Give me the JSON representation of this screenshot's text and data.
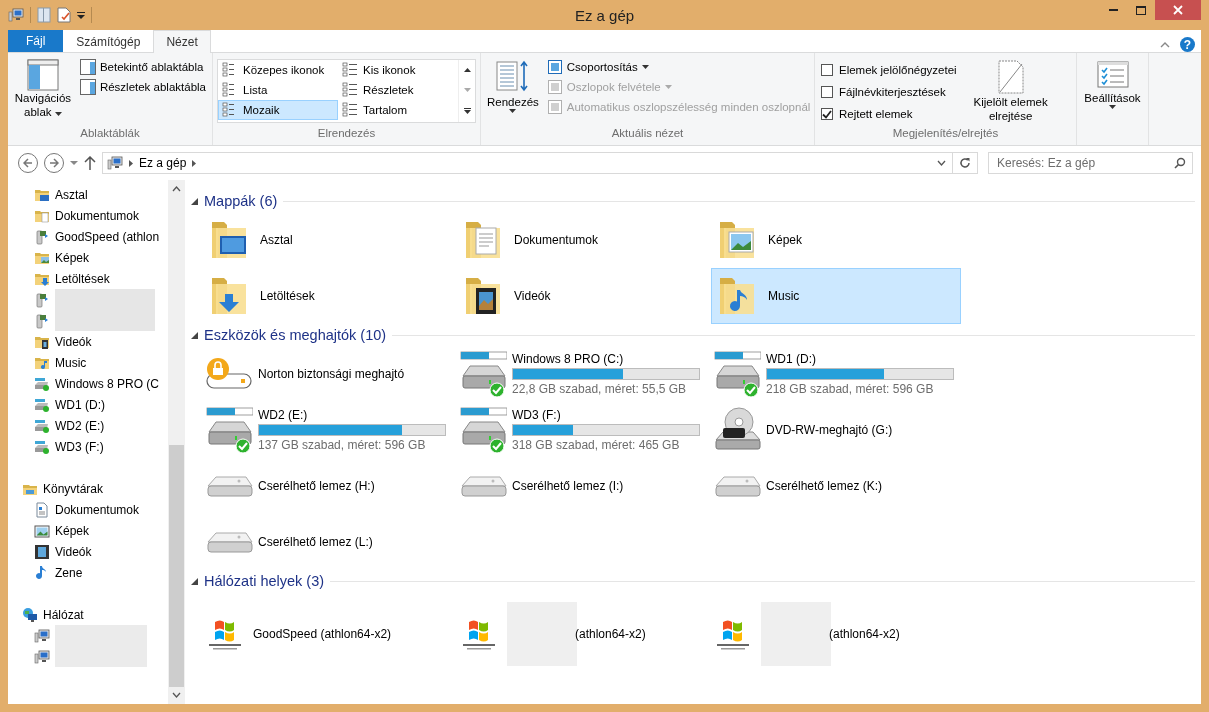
{
  "window": {
    "title": "Ez a gép"
  },
  "tabs": [
    {
      "label": "Fájl",
      "kind": "file",
      "selected": false
    },
    {
      "label": "Számítógép",
      "kind": "tab",
      "selected": false
    },
    {
      "label": "Nézet",
      "kind": "tab",
      "selected": true
    }
  ],
  "ribbon": {
    "panes": {
      "nav_pane": "Navigációs ablak",
      "items": [
        "Betekintő ablaktábla",
        "Részletek ablaktábla"
      ],
      "group": "Ablaktáblák"
    },
    "layout": {
      "options": [
        {
          "label": "Közepes ikonok",
          "selected": false
        },
        {
          "label": "Kis ikonok",
          "selected": false
        },
        {
          "label": "Lista",
          "selected": false
        },
        {
          "label": "Részletek",
          "selected": false
        },
        {
          "label": "Mozaik",
          "selected": true
        },
        {
          "label": "Tartalom",
          "selected": false
        }
      ],
      "group": "Elrendezés"
    },
    "current_view": {
      "sort": "Rendezés",
      "items": [
        {
          "label": "Csoportosítás",
          "disabled": false,
          "dropdown": true
        },
        {
          "label": "Oszlopok felvétele",
          "disabled": true,
          "dropdown": true
        },
        {
          "label": "Automatikus oszlopszélesség minden oszlopnál",
          "disabled": true,
          "dropdown": false
        }
      ],
      "group": "Aktuális nézet"
    },
    "show_hide": {
      "checkboxes": [
        {
          "label": "Elemek jelölőnégyzetei",
          "checked": false
        },
        {
          "label": "Fájlnévkiterjesztések",
          "checked": false
        },
        {
          "label": "Rejtett elemek",
          "checked": true
        }
      ],
      "hide_selected": "Kijelölt elemek elrejtése",
      "group": "Megjelenítés/elrejtés"
    },
    "options": "Beállítások",
    "help": "?"
  },
  "address": {
    "path": [
      "Ez a gép"
    ],
    "search_placeholder": "Keresés: Ez a gép"
  },
  "sidebar": {
    "sections": [
      {
        "items": [
          {
            "label": "Asztal",
            "kind": "desktop",
            "redacted": false
          },
          {
            "label": "Dokumentumok",
            "kind": "documents",
            "redacted": false
          },
          {
            "label": "GoodSpeed (athlon",
            "kind": "media",
            "redacted": false
          },
          {
            "label": "Képek",
            "kind": "pictures",
            "redacted": false
          },
          {
            "label": "Letöltések",
            "kind": "downloads",
            "redacted": false
          },
          {
            "kind": "media",
            "redacted": true
          },
          {
            "kind": "media",
            "redacted": true
          },
          {
            "label": "Videók",
            "kind": "videos",
            "redacted": false
          },
          {
            "label": "Music",
            "kind": "music",
            "redacted": false
          },
          {
            "label": "Windows 8 PRO (C",
            "kind": "drive",
            "redacted": false
          },
          {
            "label": "WD1 (D:)",
            "kind": "drive",
            "redacted": false
          },
          {
            "label": "WD2 (E:)",
            "kind": "drive",
            "redacted": false
          },
          {
            "label": "WD3 (F:)",
            "kind": "drive",
            "redacted": false
          }
        ]
      },
      {
        "label": "Könyvtárak",
        "kind": "library",
        "items": [
          {
            "label": "Dokumentumok",
            "kind": "lib-documents",
            "redacted": false
          },
          {
            "label": "Képek",
            "kind": "lib-pictures",
            "redacted": false
          },
          {
            "label": "Videók",
            "kind": "lib-videos",
            "redacted": false
          },
          {
            "label": "Zene",
            "kind": "lib-music",
            "redacted": false
          }
        ]
      },
      {
        "label": "Hálózat",
        "kind": "network",
        "items": [
          {
            "kind": "computer",
            "redacted": true
          },
          {
            "kind": "computer",
            "redacted": true
          }
        ]
      }
    ]
  },
  "groups": [
    {
      "title": "Mappák (6)",
      "kind": "folders",
      "items": [
        {
          "label": "Asztal",
          "kind": "desktop",
          "selected": false
        },
        {
          "label": "Dokumentumok",
          "kind": "documents",
          "selected": false
        },
        {
          "label": "Képek",
          "kind": "pictures",
          "selected": false
        },
        {
          "label": "Letöltések",
          "kind": "downloads",
          "selected": false
        },
        {
          "label": "Videók",
          "kind": "videos",
          "selected": false
        },
        {
          "label": "Music",
          "kind": "music",
          "selected": true
        }
      ]
    },
    {
      "title": "Eszközök és meghajtók (10)",
      "kind": "devices",
      "items": [
        {
          "label": "Norton biztonsági meghajtó",
          "kind": "locked"
        },
        {
          "label": "Windows 8 PRO (C:)",
          "kind": "drive",
          "level": 0.59,
          "free": "22,8 GB szabad, méret: 55,5 GB"
        },
        {
          "label": "WD1 (D:)",
          "kind": "drive",
          "level": 0.63,
          "free": "218 GB szabad, méret: 596 GB"
        },
        {
          "label": "WD2 (E:)",
          "kind": "drive",
          "level": 0.77,
          "free": "137 GB szabad, méret: 596 GB"
        },
        {
          "label": "WD3 (F:)",
          "kind": "drive",
          "level": 0.32,
          "free": "318 GB szabad, méret: 465 GB"
        },
        {
          "label": "DVD-RW-meghajtó (G:)",
          "kind": "dvd"
        },
        {
          "label": "Cserélhető lemez (H:)",
          "kind": "removable"
        },
        {
          "label": "Cserélhető lemez (I:)",
          "kind": "removable"
        },
        {
          "label": "Cserélhető lemez (K:)",
          "kind": "removable"
        },
        {
          "label": "Cserélhető lemez (L:)",
          "kind": "removable"
        }
      ]
    },
    {
      "title": "Hálózati helyek (3)",
      "kind": "network",
      "items": [
        {
          "label": "GoodSpeed (athlon64-x2)",
          "kind": "media",
          "redacted": false
        },
        {
          "label": "(athlon64-x2)",
          "kind": "media",
          "redacted": true
        },
        {
          "label": "(athlon64-x2)",
          "kind": "media",
          "redacted": true
        }
      ]
    }
  ]
}
